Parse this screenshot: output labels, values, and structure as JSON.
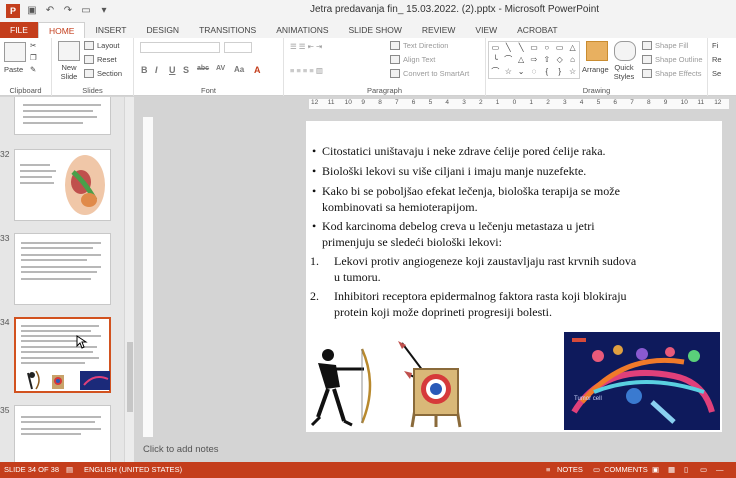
{
  "window": {
    "title": "Jetra predavanja fin_ 15.03.2022. (2).pptx - Microsoft PowerPoint",
    "app_logo": "P"
  },
  "tabs": [
    {
      "label": "FILE"
    },
    {
      "label": "HOME"
    },
    {
      "label": "INSERT"
    },
    {
      "label": "DESIGN"
    },
    {
      "label": "TRANSITIONS"
    },
    {
      "label": "ANIMATIONS"
    },
    {
      "label": "SLIDE SHOW"
    },
    {
      "label": "REVIEW"
    },
    {
      "label": "VIEW"
    },
    {
      "label": "ACROBAT"
    }
  ],
  "ribbon": {
    "clipboard": {
      "label": "Clipboard",
      "paste": "Paste"
    },
    "slides": {
      "label": "Slides",
      "new_slide": "New Slide",
      "layout": "Layout",
      "reset": "Reset",
      "section": "Section"
    },
    "font": {
      "label": "Font",
      "format_buttons": [
        "B",
        "I",
        "U",
        "S",
        "abc",
        "AV",
        "Aa",
        "A"
      ]
    },
    "paragraph": {
      "label": "Paragraph",
      "text_direction": "Text Direction",
      "align_text": "Align Text",
      "convert_smartart": "Convert to SmartArt"
    },
    "drawing": {
      "label": "Drawing",
      "arrange": "Arrange",
      "quick_styles": "Quick Styles",
      "shape_fill": "Shape Fill",
      "shape_outline": "Shape Outline",
      "shape_effects": "Shape Effects"
    },
    "editing": {
      "find": "Fi",
      "replace": "Re",
      "select": "Se"
    }
  },
  "thumbnails": [
    {
      "number": "",
      "kind": "text"
    },
    {
      "number": "32",
      "kind": "anatomy"
    },
    {
      "number": "33",
      "kind": "text"
    },
    {
      "number": "34",
      "kind": "current"
    },
    {
      "number": "35",
      "kind": "text"
    }
  ],
  "ruler": {
    "marks": [
      "12",
      "11",
      "10",
      "9",
      "8",
      "7",
      "6",
      "5",
      "4",
      "3",
      "2",
      "1",
      "0",
      "1",
      "2",
      "3",
      "4",
      "5",
      "6",
      "7",
      "8",
      "9",
      "10",
      "11",
      "12"
    ]
  },
  "slide": {
    "bullets": [
      {
        "lines": [
          "Citostatici uništavaju i neke zdrave ćelije pored ćelije raka."
        ]
      },
      {
        "lines": [
          "Biološki lekovi su više ciljani i imaju manje nuzefekte."
        ]
      },
      {
        "lines": [
          "Kako bi se poboljšao efekat lečenja, biološka terapija se može",
          "kombinovati sa hemioterapijom."
        ]
      },
      {
        "lines": [
          "Kod karcinoma debelog creva u lečenju metastaza u jetri",
          "primenjuju se sledeći biološki lekovi:"
        ]
      }
    ],
    "numbered": [
      {
        "n": "1.",
        "lines": [
          "Lekovi protiv angiogeneze koji zaustavljaju rast krvnih sudova",
          "u tumoru."
        ]
      },
      {
        "n": "2.",
        "lines": [
          "Inhibitori receptora epidermalnog faktora rasta koji blokiraju",
          "protein koji može doprineti progresiji bolesti."
        ]
      }
    ],
    "bullet_symbol": "•",
    "figure_label": "Tumor cell"
  },
  "notes_placeholder": "Click to add notes",
  "status": {
    "slide_indicator": "SLIDE 34 OF 38",
    "language": "ENGLISH (UNITED STATES)",
    "notes": "NOTES",
    "comments": "COMMENTS"
  },
  "colors": {
    "accent": "#c43e1c",
    "selected_thumb": "#d2521f"
  }
}
